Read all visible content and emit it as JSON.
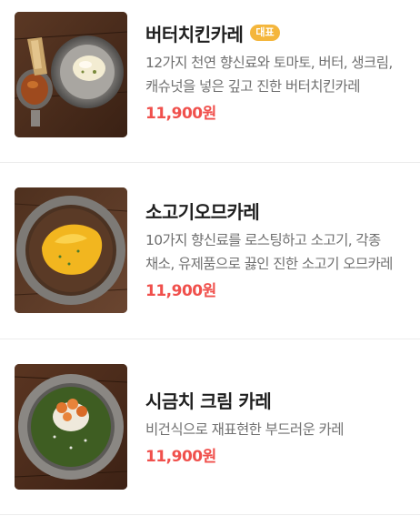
{
  "menu": {
    "items": [
      {
        "title": "버터치킨카레",
        "badge": "대표",
        "description": "12가지 천연 향신료와 토마토, 버터, 생크림, 캐슈넛을 넣은 깊고 진한 버터치킨카레",
        "price": "11,900원",
        "image": "butter-chicken-curry-photo"
      },
      {
        "title": "소고기오므카레",
        "badge": "",
        "description": "10가지 향신료를 로스팅하고 소고기, 각종 채소, 유제품으로 끓인 진한 소고기 오므카레",
        "price": "11,900원",
        "image": "beef-omelette-curry-photo"
      },
      {
        "title": "시금치 크림 카레",
        "badge": "",
        "description": "비건식으로 재표현한 부드러운 카레",
        "price": "11,900원",
        "image": "spinach-cream-curry-photo"
      }
    ]
  },
  "colors": {
    "badge": "#f4b63c",
    "price": "#f0504c",
    "title": "#1f1f1f",
    "description": "#707070"
  }
}
